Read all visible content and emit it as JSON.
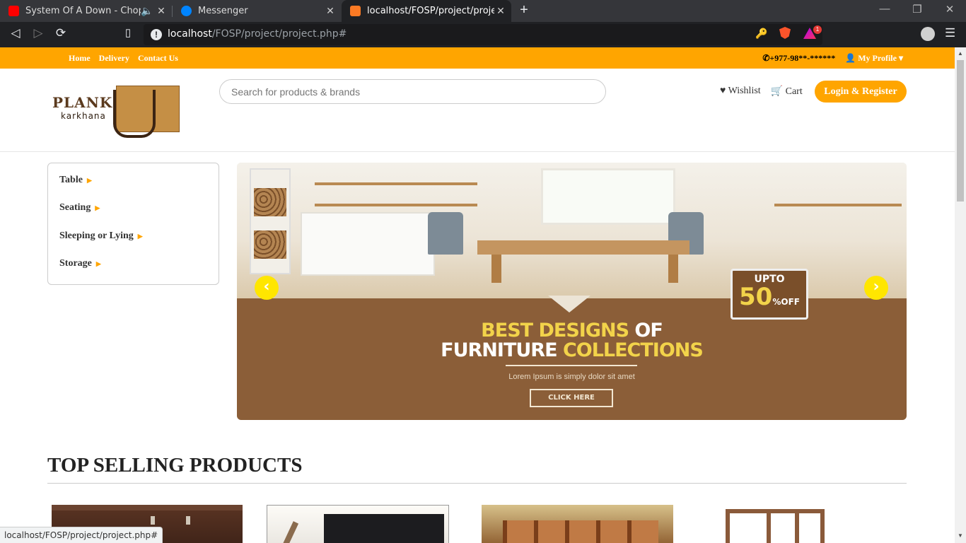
{
  "browser": {
    "tabs": [
      {
        "title": "System Of A Down - Chop Suey",
        "favicon_color": "#ff0000"
      },
      {
        "title": "Messenger",
        "favicon_color": "#0084ff"
      },
      {
        "title": "localhost/FOSP/project/project.php#",
        "favicon_color": "#fb7a24"
      }
    ],
    "url_host": "localhost",
    "url_path": "/FOSP/project/project.php#",
    "rewards_badge": "1"
  },
  "topbar": {
    "links": [
      "Home",
      "Delivery",
      "Contact Us"
    ],
    "phone": "+977-98**-******",
    "profile": "My Profile"
  },
  "header": {
    "logo_word1": "PLANK",
    "logo_word2": "karkhana",
    "search_placeholder": "Search for products & brands",
    "wishlist": "Wishlist",
    "cart": "Cart",
    "login": "Login & Register"
  },
  "categories": [
    "Table",
    "Seating",
    "Sleeping or Lying",
    "Storage"
  ],
  "banner": {
    "promo_upto": "UPTO",
    "promo_pct": "50",
    "promo_pct_unit": "%",
    "promo_off": "OFF",
    "headline1_a": "BEST DESIGNS",
    "headline1_b": "OF",
    "headline2_a": "FURNITURE",
    "headline2_b": "COLLECTIONS",
    "lorem": "Lorem Ipsum is simply dolor sit amet",
    "cta": "CLICK HERE"
  },
  "section": {
    "title": "TOP SELLING PRODUCTS"
  },
  "status_url": "localhost/FOSP/project/project.php#"
}
